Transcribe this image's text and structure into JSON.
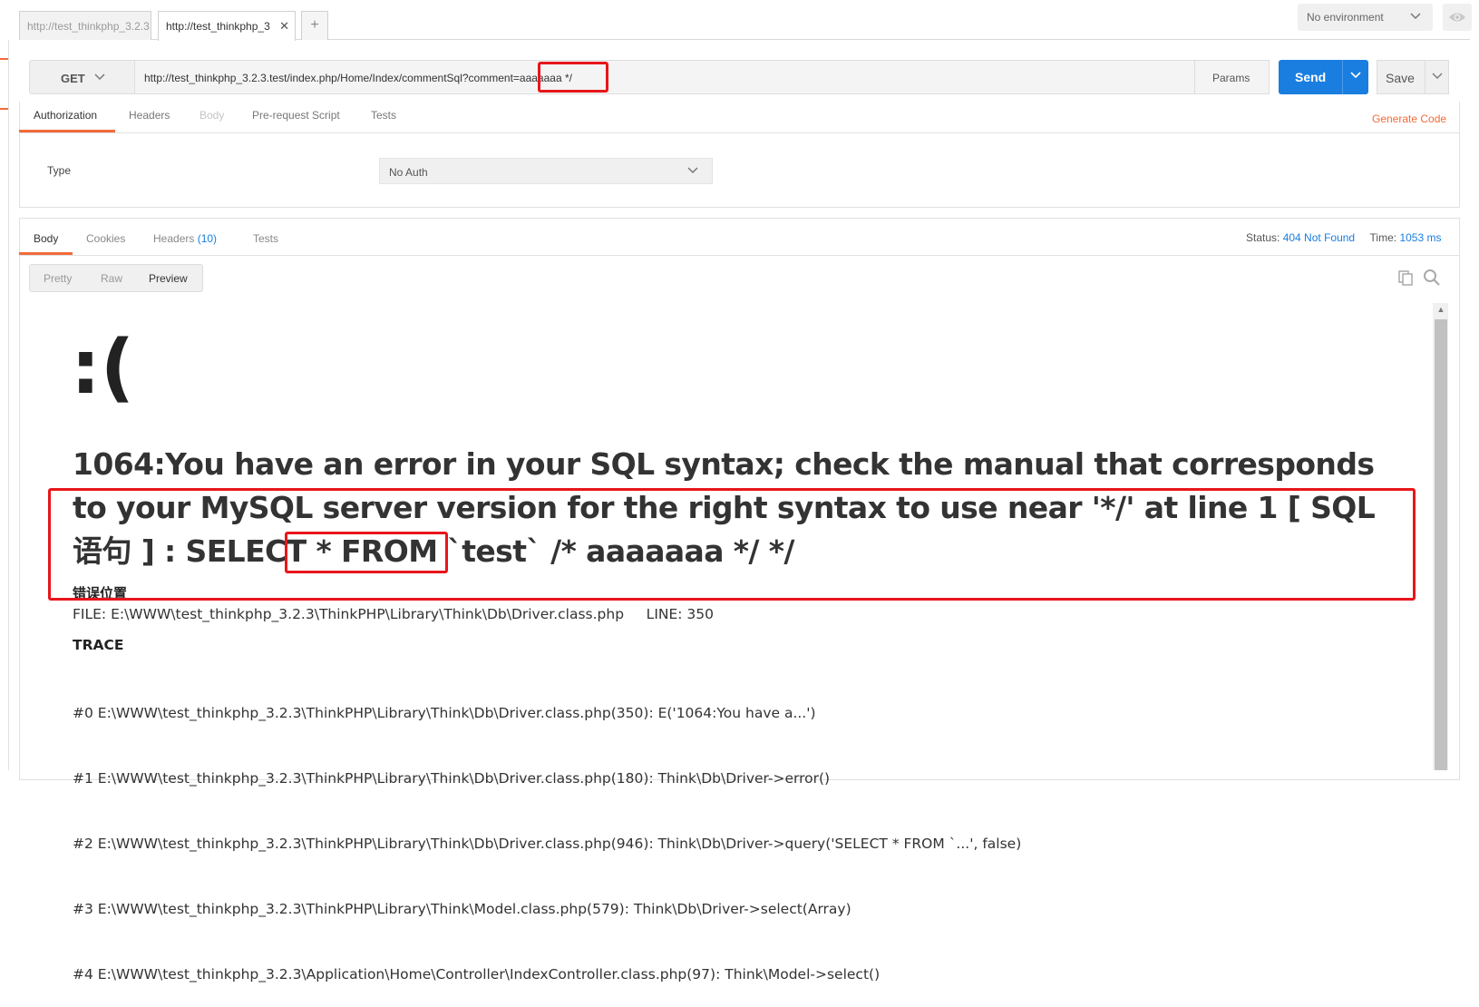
{
  "tabs": [
    {
      "label": "http://test_thinkphp_3.2.3"
    },
    {
      "label": "http://test_thinkphp_3"
    }
  ],
  "tab_close": "✕",
  "tab_add": "+",
  "environment": {
    "selected": "No environment"
  },
  "request": {
    "method": "GET",
    "url": "http://test_thinkphp_3.2.3.test/index.php/Home/Index/commentSql?comment=aaaaaaa */",
    "params_label": "Params",
    "send_label": "Send",
    "save_label": "Save"
  },
  "request_tabs": [
    "Authorization",
    "Headers",
    "Body",
    "Pre-request Script",
    "Tests"
  ],
  "generate_code": "Generate Code",
  "auth": {
    "type_label": "Type",
    "selected": "No Auth"
  },
  "response_tabs": {
    "body": "Body",
    "cookies": "Cookies",
    "headers": "Headers",
    "headers_count": "(10)",
    "tests": "Tests"
  },
  "status": {
    "label": "Status:",
    "value": "404 Not Found",
    "time_label": "Time:",
    "time_value": "1053 ms"
  },
  "view_modes": [
    "Pretty",
    "Raw",
    "Preview"
  ],
  "preview": {
    "face": ":(",
    "error_message": "1064:You have an error in your SQL syntax; check the manual that corresponds to your MySQL server version for the right syntax to use near '*/' at line 1 [ SQL语句 ] : SELECT * FROM `test` /* aaaaaaa */ */",
    "error_location_heading": "错误位置",
    "file_line": "FILE: E:\\WWW\\test_thinkphp_3.2.3\\ThinkPHP\\Library\\Think\\Db\\Driver.class.php     LINE: 350",
    "trace_heading": "TRACE",
    "trace_lines": [
      "#0 E:\\WWW\\test_thinkphp_3.2.3\\ThinkPHP\\Library\\Think\\Db\\Driver.class.php(350): E('1064:You have a...')",
      "#1 E:\\WWW\\test_thinkphp_3.2.3\\ThinkPHP\\Library\\Think\\Db\\Driver.class.php(180): Think\\Db\\Driver->error()",
      "#2 E:\\WWW\\test_thinkphp_3.2.3\\ThinkPHP\\Library\\Think\\Db\\Driver.class.php(946): Think\\Db\\Driver->query('SELECT * FROM `...', false)",
      "#3 E:\\WWW\\test_thinkphp_3.2.3\\ThinkPHP\\Library\\Think\\Model.class.php(579): Think\\Db\\Driver->select(Array)",
      "#4 E:\\WWW\\test_thinkphp_3.2.3\\Application\\Home\\Controller\\IndexController.class.php(97): Think\\Model->select()"
    ]
  },
  "colors": {
    "accent": "#f26b3a",
    "send": "#1a7ee0",
    "annotation": "#e8161b"
  }
}
